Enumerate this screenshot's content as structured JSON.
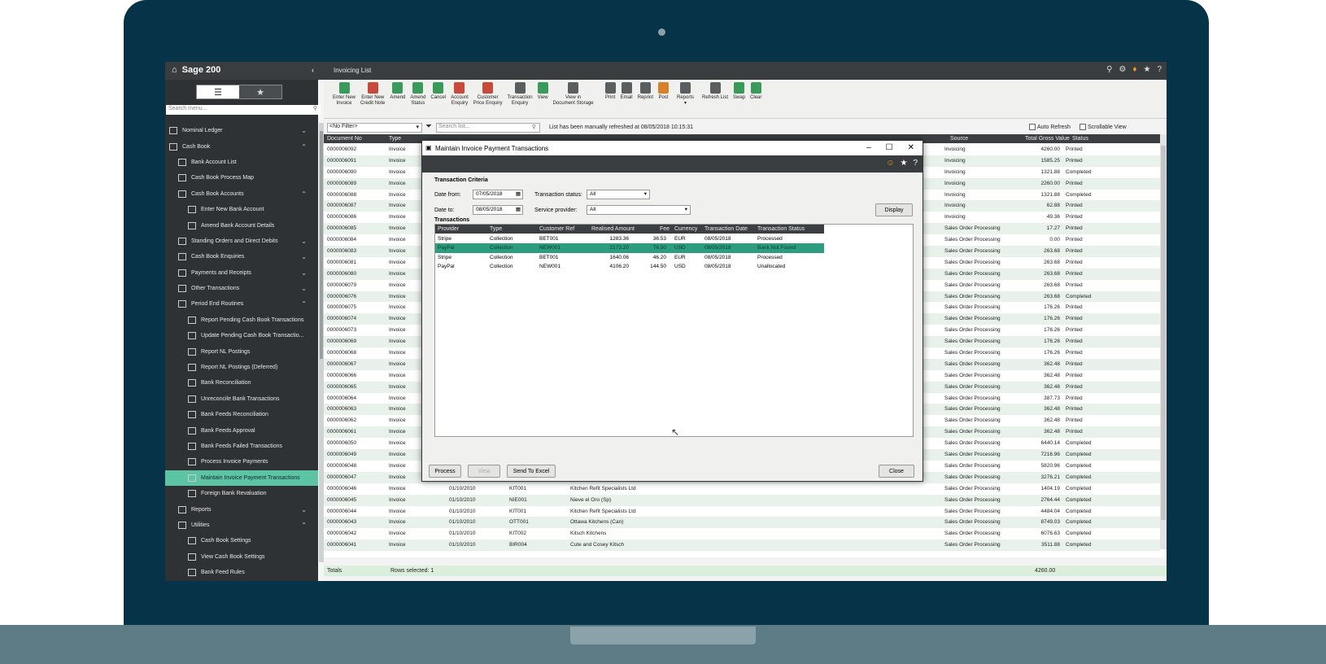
{
  "app": {
    "brand": "Sage 200",
    "window_title": "Invoicing List"
  },
  "sidebar": {
    "search_placeholder": "Search menu...",
    "items": [
      {
        "label": "Nominal Ledger",
        "level": 1,
        "chevron": "v"
      },
      {
        "label": "Cash Book",
        "level": 1,
        "chevron": "^"
      },
      {
        "label": "Bank Account List",
        "level": 2
      },
      {
        "label": "Cash Book Process Map",
        "level": 2
      },
      {
        "label": "Cash Book Accounts",
        "level": 2,
        "chevron": "^"
      },
      {
        "label": "Enter New Bank Account",
        "level": 3
      },
      {
        "label": "Amend Bank Account Details",
        "level": 3
      },
      {
        "label": "Standing Orders and Direct Debits",
        "level": 2,
        "chevron": "v"
      },
      {
        "label": "Cash Book Enquiries",
        "level": 2,
        "chevron": "v"
      },
      {
        "label": "Payments and Receipts",
        "level": 2,
        "chevron": "v"
      },
      {
        "label": "Other Transactions",
        "level": 2,
        "chevron": "v"
      },
      {
        "label": "Period End Routines",
        "level": 2,
        "chevron": "^"
      },
      {
        "label": "Report Pending Cash Book Transactions",
        "level": 3
      },
      {
        "label": "Update Pending Cash Book Transactio...",
        "level": 3
      },
      {
        "label": "Report NL Postings",
        "level": 3
      },
      {
        "label": "Report NL Postings (Deferred)",
        "level": 3
      },
      {
        "label": "Bank Reconciliation",
        "level": 3
      },
      {
        "label": "Unreconcile Bank Transactions",
        "level": 3
      },
      {
        "label": "Bank Feeds Reconciliation",
        "level": 3
      },
      {
        "label": "Bank Feeds Approval",
        "level": 3
      },
      {
        "label": "Bank Feeds Failed Transactions",
        "level": 3
      },
      {
        "label": "Process Invoice Payments",
        "level": 3
      },
      {
        "label": "Maintain Invoice Payment Transactions",
        "level": 3,
        "selected": true
      },
      {
        "label": "Foreign Bank Revaluation",
        "level": 3
      },
      {
        "label": "Reports",
        "level": 2,
        "chevron": "v"
      },
      {
        "label": "Utilities",
        "level": 2,
        "chevron": "^"
      },
      {
        "label": "Cash Book Settings",
        "level": 3
      },
      {
        "label": "View Cash Book Settings",
        "level": 3
      },
      {
        "label": "Bank Feed Rules",
        "level": 3
      }
    ]
  },
  "toolbar": {
    "buttons": [
      {
        "label": "Enter New\nInvoice",
        "color": "green"
      },
      {
        "label": "Enter New\nCredit Note",
        "color": "red"
      },
      {
        "label": "Amend",
        "color": "green"
      },
      {
        "label": "Amend\nStatus",
        "color": "green"
      },
      {
        "label": "Cancel",
        "color": "green"
      },
      {
        "label": "Account\nEnquiry",
        "color": "red"
      },
      {
        "label": "Customer\nPrice Enquiry",
        "color": "red"
      },
      {
        "label": "Transaction\nEnquiry",
        "color": "dark"
      },
      {
        "label": "View",
        "color": "green"
      },
      {
        "label": "View in\nDocument Storage",
        "color": "dark"
      },
      {
        "label": "Print",
        "color": "dark"
      },
      {
        "label": "Email",
        "color": "dark"
      },
      {
        "label": "Reprint",
        "color": "dark"
      },
      {
        "label": "Post",
        "color": "orange"
      },
      {
        "label": "Reports\n▾",
        "color": "dark"
      },
      {
        "label": "Refresh List",
        "color": "dark"
      },
      {
        "label": "Swap",
        "color": "green"
      },
      {
        "label": "Clear",
        "color": "green"
      }
    ]
  },
  "filter": {
    "filter_value": "<No Filter>",
    "search_placeholder": "Search list...",
    "refresh_message": "List has been manually refreshed at 08/05/2018 10:15:31",
    "auto_refresh": "Auto Refresh",
    "scrollable_view": "Scrollable View"
  },
  "grid": {
    "headers": {
      "doc": "Document No",
      "type": "Type",
      "source": "Source",
      "gross": "Total Gross Value",
      "status": "Status"
    },
    "rows": [
      {
        "doc": "0000006092",
        "type": "Invoice",
        "date": "",
        "acct": "",
        "name": "",
        "source": "Invoicing",
        "gross": "4260.00",
        "status": "Printed"
      },
      {
        "doc": "0000006091",
        "type": "Invoice",
        "date": "",
        "acct": "",
        "name": "",
        "source": "Invoicing",
        "gross": "1585.25",
        "status": "Printed"
      },
      {
        "doc": "0000006090",
        "type": "Invoice",
        "date": "",
        "acct": "",
        "name": "",
        "source": "Invoicing",
        "gross": "1321.88",
        "status": "Completed"
      },
      {
        "doc": "0000006089",
        "type": "Invoice",
        "date": "",
        "acct": "",
        "name": "",
        "source": "Invoicing",
        "gross": "2260.00",
        "status": "Printed"
      },
      {
        "doc": "0000006088",
        "type": "Invoice",
        "date": "",
        "acct": "",
        "name": "",
        "source": "Invoicing",
        "gross": "1321.88",
        "status": "Completed"
      },
      {
        "doc": "0000006087",
        "type": "Invoice",
        "date": "",
        "acct": "",
        "name": "",
        "source": "Invoicing",
        "gross": "62.88",
        "status": "Printed"
      },
      {
        "doc": "0000006086",
        "type": "Invoice",
        "date": "",
        "acct": "",
        "name": "",
        "source": "Invoicing",
        "gross": "49.36",
        "status": "Printed"
      },
      {
        "doc": "0000006085",
        "type": "Invoice",
        "date": "",
        "acct": "",
        "name": "",
        "source": "Sales Order Processing",
        "gross": "17.27",
        "status": "Printed"
      },
      {
        "doc": "0000006084",
        "type": "Invoice",
        "date": "",
        "acct": "",
        "name": "",
        "source": "Sales Order Processing",
        "gross": "0.00",
        "status": "Printed"
      },
      {
        "doc": "0000006083",
        "type": "Invoice",
        "date": "",
        "acct": "",
        "name": "",
        "source": "Sales Order Processing",
        "gross": "263.68",
        "status": "Printed"
      },
      {
        "doc": "0000006081",
        "type": "Invoice",
        "date": "",
        "acct": "",
        "name": "",
        "source": "Sales Order Processing",
        "gross": "263.68",
        "status": "Printed"
      },
      {
        "doc": "0000006080",
        "type": "Invoice",
        "date": "",
        "acct": "",
        "name": "",
        "source": "Sales Order Processing",
        "gross": "263.68",
        "status": "Printed"
      },
      {
        "doc": "0000006079",
        "type": "Invoice",
        "date": "",
        "acct": "",
        "name": "",
        "source": "Sales Order Processing",
        "gross": "263.68",
        "status": "Printed"
      },
      {
        "doc": "0000006076",
        "type": "Invoice",
        "date": "",
        "acct": "",
        "name": "",
        "source": "Sales Order Processing",
        "gross": "263.68",
        "status": "Completed"
      },
      {
        "doc": "0000006075",
        "type": "Invoice",
        "date": "",
        "acct": "",
        "name": "",
        "source": "Sales Order Processing",
        "gross": "176.26",
        "status": "Printed"
      },
      {
        "doc": "0000006074",
        "type": "Invoice",
        "date": "",
        "acct": "",
        "name": "",
        "source": "Sales Order Processing",
        "gross": "176.26",
        "status": "Printed"
      },
      {
        "doc": "0000006073",
        "type": "Invoice",
        "date": "",
        "acct": "",
        "name": "",
        "source": "Sales Order Processing",
        "gross": "176.26",
        "status": "Printed"
      },
      {
        "doc": "0000006069",
        "type": "Invoice",
        "date": "",
        "acct": "",
        "name": "",
        "source": "Sales Order Processing",
        "gross": "176.26",
        "status": "Printed"
      },
      {
        "doc": "0000006068",
        "type": "Invoice",
        "date": "",
        "acct": "",
        "name": "",
        "source": "Sales Order Processing",
        "gross": "176.26",
        "status": "Printed"
      },
      {
        "doc": "0000006067",
        "type": "Invoice",
        "date": "",
        "acct": "",
        "name": "",
        "source": "Sales Order Processing",
        "gross": "362.48",
        "status": "Printed"
      },
      {
        "doc": "0000006066",
        "type": "Invoice",
        "date": "",
        "acct": "",
        "name": "",
        "source": "Sales Order Processing",
        "gross": "362.48",
        "status": "Printed"
      },
      {
        "doc": "0000006065",
        "type": "Invoice",
        "date": "",
        "acct": "",
        "name": "",
        "source": "Sales Order Processing",
        "gross": "362.48",
        "status": "Printed"
      },
      {
        "doc": "0000006064",
        "type": "Invoice",
        "date": "",
        "acct": "",
        "name": "",
        "source": "Sales Order Processing",
        "gross": "387.73",
        "status": "Printed"
      },
      {
        "doc": "0000006063",
        "type": "Invoice",
        "date": "",
        "acct": "",
        "name": "",
        "source": "Sales Order Processing",
        "gross": "362.48",
        "status": "Printed"
      },
      {
        "doc": "0000006062",
        "type": "Invoice",
        "date": "",
        "acct": "",
        "name": "",
        "source": "Sales Order Processing",
        "gross": "362.48",
        "status": "Printed"
      },
      {
        "doc": "0000006061",
        "type": "Invoice",
        "date": "",
        "acct": "",
        "name": "",
        "source": "Sales Order Processing",
        "gross": "362.48",
        "status": "Printed"
      },
      {
        "doc": "0000006050",
        "type": "Invoice",
        "date": "",
        "acct": "",
        "name": "",
        "source": "Sales Order Processing",
        "gross": "6440.14",
        "status": "Completed"
      },
      {
        "doc": "0000006049",
        "type": "Invoice",
        "date": "",
        "acct": "",
        "name": "",
        "source": "Sales Order Processing",
        "gross": "7216.96",
        "status": "Completed"
      },
      {
        "doc": "0000006048",
        "type": "Invoice",
        "date": "",
        "acct": "",
        "name": "",
        "source": "Sales Order Processing",
        "gross": "5820.96",
        "status": "Completed"
      },
      {
        "doc": "0000006047",
        "type": "Invoice",
        "date": "01/10/2010",
        "acct": "ABB001",
        "name": "Abbey Retail Ltd",
        "source": "Sales Order Processing",
        "gross": "3276.21",
        "status": "Completed"
      },
      {
        "doc": "0000006046",
        "type": "Invoice",
        "date": "01/10/2010",
        "acct": "KIT001",
        "name": "Kitchen Refit Specialists Ltd",
        "source": "Sales Order Processing",
        "gross": "1404.19",
        "status": "Completed"
      },
      {
        "doc": "0000006045",
        "type": "Invoice",
        "date": "01/10/2010",
        "acct": "NIE001",
        "name": "Nieve el Oro (Sp)",
        "source": "Sales Order Processing",
        "gross": "2764.44",
        "status": "Completed"
      },
      {
        "doc": "0000006044",
        "type": "Invoice",
        "date": "01/10/2010",
        "acct": "KIT001",
        "name": "Kitchen Refit Specialists Ltd",
        "source": "Sales Order Processing",
        "gross": "4484.04",
        "status": "Completed"
      },
      {
        "doc": "0000006043",
        "type": "Invoice",
        "date": "01/10/2010",
        "acct": "OTT001",
        "name": "Ottawa Kitchens (Can)",
        "source": "Sales Order Processing",
        "gross": "8749.03",
        "status": "Completed"
      },
      {
        "doc": "0000006042",
        "type": "Invoice",
        "date": "01/10/2010",
        "acct": "KIT002",
        "name": "Kitsch Kitchens",
        "source": "Sales Order Processing",
        "gross": "6076.63",
        "status": "Completed"
      },
      {
        "doc": "0000006041",
        "type": "Invoice",
        "date": "01/10/2010",
        "acct": "BIR004",
        "name": "Cute and Cosey Kitsch",
        "source": "Sales Order Processing",
        "gross": "3511.88",
        "status": "Completed"
      }
    ],
    "totals_label": "Totals",
    "rows_selected": "Rows selected: 1",
    "totals_gross": "4260.00"
  },
  "dialog": {
    "title": "Maintain Invoice Payment Transactions",
    "criteria_heading": "Transaction Criteria",
    "date_from_label": "Date from:",
    "date_from": "07/05/2018",
    "date_to_label": "Date to:",
    "date_to": "08/05/2018",
    "status_label": "Transaction status:",
    "status_value": "All",
    "provider_label": "Service provider:",
    "provider_value": "All",
    "display_btn": "Display",
    "transactions_heading": "Transactions",
    "headers": {
      "provider": "Provider",
      "type": "Type",
      "ref": "Customer Ref",
      "amount": "Realised Amount",
      "fee": "Fee",
      "currency": "Currency",
      "date": "Transaction Date",
      "status": "Transaction Status"
    },
    "rows": [
      {
        "provider": "Stripe",
        "type": "Collection",
        "ref": "BET001",
        "amount": "1283.36",
        "fee": "36.53",
        "currency": "EUR",
        "date": "08/05/2018",
        "status": "Processed",
        "highlight": false
      },
      {
        "provider": "PayPal",
        "type": "Collection",
        "ref": "NEW001",
        "amount": "2173.20",
        "fee": "76.50",
        "currency": "USD",
        "date": "08/05/2018",
        "status": "Bank Not Found",
        "highlight": true
      },
      {
        "provider": "Stripe",
        "type": "Collection",
        "ref": "BET001",
        "amount": "1640.06",
        "fee": "46.20",
        "currency": "EUR",
        "date": "08/05/2018",
        "status": "Processed",
        "highlight": false
      },
      {
        "provider": "PayPal",
        "type": "Collection",
        "ref": "NEW001",
        "amount": "4106.20",
        "fee": "144.50",
        "currency": "USD",
        "date": "08/05/2018",
        "status": "Unallocated",
        "highlight": false
      }
    ],
    "process_btn": "Process",
    "view_btn": "View",
    "excel_btn": "Send To Excel",
    "close_btn": "Close"
  }
}
